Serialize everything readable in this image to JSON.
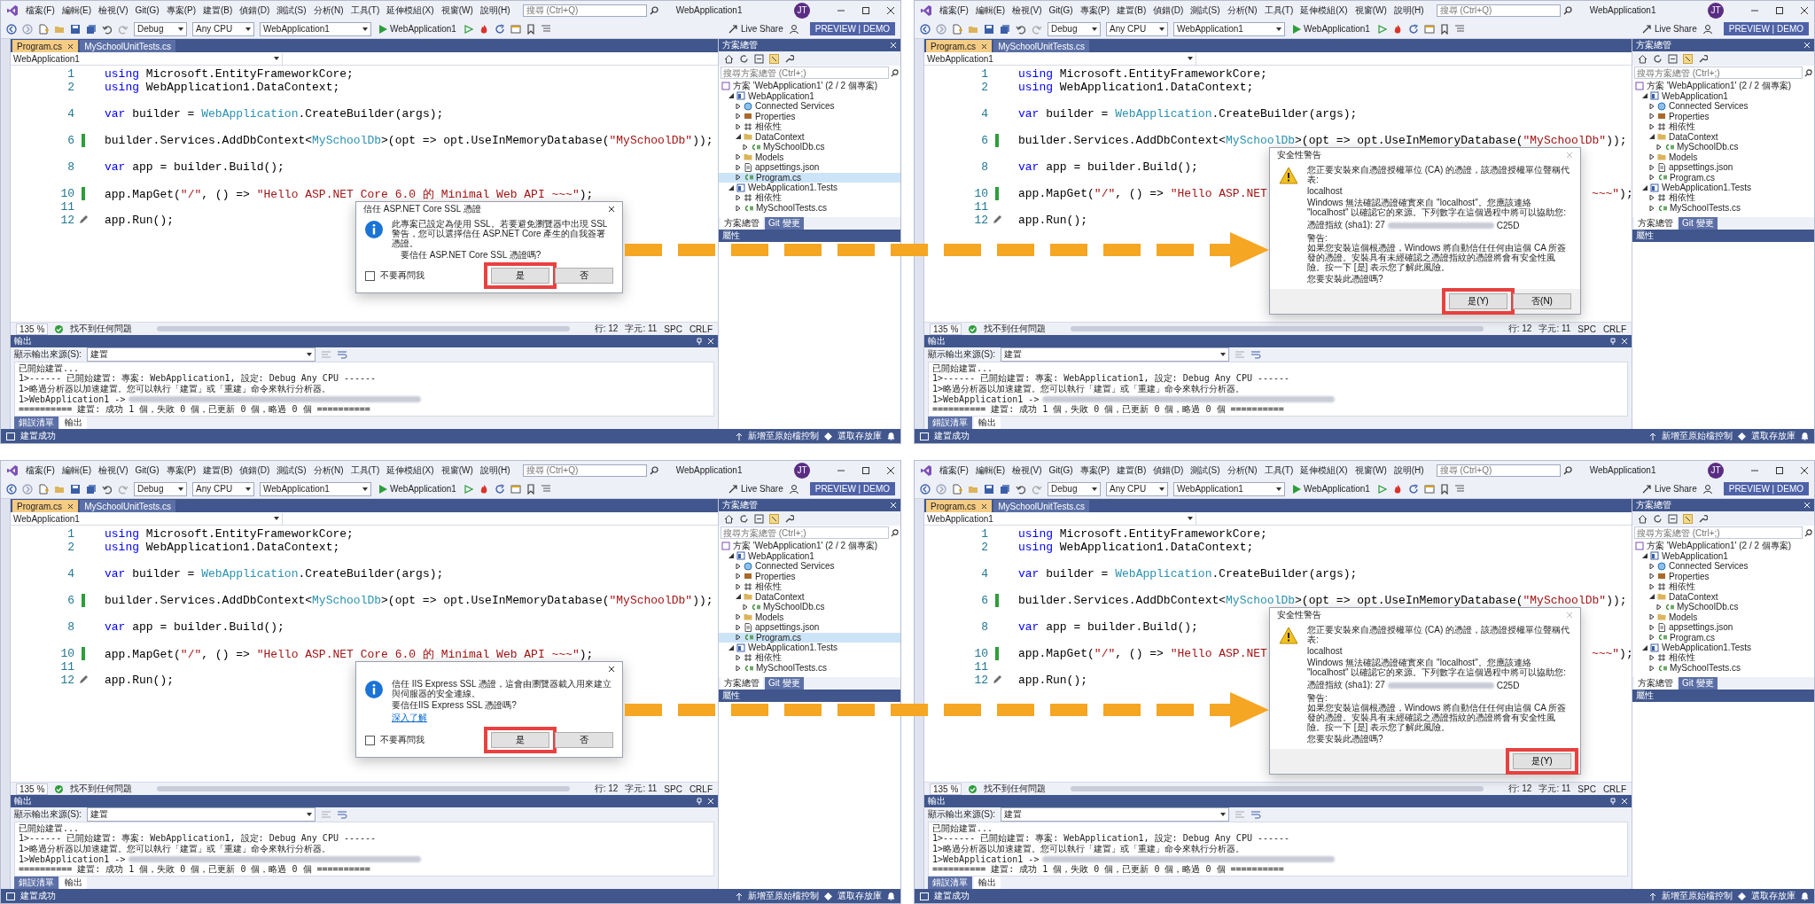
{
  "panels": [
    {
      "menu": [
        "檔案(F)",
        "編輯(E)",
        "檢視(V)",
        "Git(G)",
        "專案(P)",
        "建置(B)",
        "偵錯(D)",
        "測試(S)",
        "分析(N)",
        "工具(T)",
        "延伸模組(X)",
        "視窗(W)",
        "說明(H)"
      ],
      "search": {
        "placeholder": "搜尋 (Ctrl+Q)"
      },
      "title": "WebApplication1",
      "avatar": "JT",
      "toolbar": {
        "configuration": "Debug",
        "platform": "Any CPU",
        "startup_project": "WebApplication1",
        "run": "WebApplication1",
        "live_share": "Live Share",
        "badge": "PREVIEW | DEMO"
      },
      "doc_tabs": [
        {
          "label": "Program.cs",
          "selected": true
        },
        {
          "label": "MySchoolUnitTests.cs",
          "selected": false
        }
      ],
      "navigation": "WebApplication1",
      "code": [
        {
          "kind": "code",
          "number": "1",
          "changed": false,
          "tokens": [
            {
              "text": "using",
              "kind": "keyword"
            },
            {
              "text": " Microsoft.EntityFrameworkCore;",
              "kind": "plain"
            }
          ]
        },
        {
          "kind": "code",
          "number": "2",
          "changed": false,
          "tokens": [
            {
              "text": "using",
              "kind": "keyword"
            },
            {
              "text": " WebApplication1.DataContext;",
              "kind": "plain"
            }
          ]
        },
        {
          "kind": "blank"
        },
        {
          "kind": "code",
          "number": "4",
          "changed": false,
          "tokens": [
            {
              "text": "var",
              "kind": "keyword"
            },
            {
              "text": " builder = ",
              "kind": "plain"
            },
            {
              "text": "WebApplication",
              "kind": "type"
            },
            {
              "text": ".CreateBuilder(args);",
              "kind": "plain"
            }
          ]
        },
        {
          "kind": "blank"
        },
        {
          "kind": "code",
          "number": "6",
          "changed": true,
          "tokens": [
            {
              "text": "builder.Services.AddDbContext<",
              "kind": "plain"
            },
            {
              "text": "MySchoolDb",
              "kind": "type"
            },
            {
              "text": ">(opt => opt.UseInMemoryDatabase(",
              "kind": "plain"
            },
            {
              "text": "\"MySchoolDb\"",
              "kind": "string"
            },
            {
              "text": "));",
              "kind": "plain"
            }
          ]
        },
        {
          "kind": "blank"
        },
        {
          "kind": "code",
          "number": "8",
          "changed": false,
          "tokens": [
            {
              "text": "var",
              "kind": "keyword"
            },
            {
              "text": " app = builder.Build();",
              "kind": "plain"
            }
          ]
        },
        {
          "kind": "blank"
        },
        {
          "kind": "code",
          "number": "10",
          "changed": true,
          "tokens": [
            {
              "text": "app.MapGet(",
              "kind": "plain"
            },
            {
              "text": "\"/\"",
              "kind": "string"
            },
            {
              "text": ", () => ",
              "kind": "plain"
            },
            {
              "text": "\"Hello ASP.NET Core 6.0 的 Minimal Web API ~~~\"",
              "kind": "string"
            },
            {
              "text": ");",
              "kind": "plain"
            }
          ]
        },
        {
          "kind": "code",
          "number": "11",
          "changed": false
        },
        {
          "kind": "code",
          "number": "12",
          "changed": false,
          "quick_action": true,
          "tokens": [
            {
              "text": "app.Run();",
              "kind": "plain"
            }
          ]
        }
      ],
      "editor_status": {
        "zoom": "135 %",
        "issues": "找不到任何問題",
        "line": "行: 12",
        "column": "字元: 11",
        "spacing": "SPC",
        "line_ending": "CRLF"
      },
      "output": {
        "title": "輸出",
        "source_label": "顯示輸出來源(S):",
        "source": "建置",
        "lines": [
          {
            "text": "已開始建置...",
            "redacted": false
          },
          {
            "text": "1>------ 已開始建置: 專案: WebApplication1, 設定: Debug Any CPU ------",
            "redacted": false
          },
          {
            "text": "1>略過分析器以加速建置。您可以執行「建置」或「重建」命令來執行分析器。",
            "redacted": false
          },
          {
            "text": "1>WebApplication1 ->",
            "redacted": true
          },
          {
            "text": "========== 建置: 成功 1 個，失敗 0 個，已更新 0 個，略過 0 個 ==========",
            "redacted": false
          }
        ],
        "tabs": [
          {
            "label": "錯誤清單",
            "selected": false
          },
          {
            "label": "輸出",
            "selected": true
          }
        ]
      },
      "status": {
        "message": "建置成功",
        "source_control": "新增至原始檔控制",
        "repository": "選取存放庫"
      },
      "solution": {
        "title": "方案總管",
        "search": {
          "placeholder": "搜尋方案總管 (Ctrl+;)"
        },
        "tree": [
          {
            "label": "方案 'WebApplication1' (2 / 2 個專案)",
            "kind": "solution",
            "selected": false,
            "children": [
              {
                "label": "WebApplication1",
                "kind": "project",
                "expanded": true,
                "selected": false,
                "children": [
                  {
                    "label": "Connected Services",
                    "kind": "services",
                    "expanded": false,
                    "selected": false
                  },
                  {
                    "label": "Properties",
                    "kind": "properties",
                    "expanded": false,
                    "selected": false
                  },
                  {
                    "label": "相依性",
                    "kind": "dependencies",
                    "expanded": false,
                    "selected": false
                  },
                  {
                    "label": "DataContext",
                    "kind": "folder",
                    "expanded": true,
                    "selected": false,
                    "children": [
                      {
                        "label": "MySchoolDb.cs",
                        "kind": "csharp",
                        "expanded": false,
                        "selected": false
                      }
                    ]
                  },
                  {
                    "label": "Models",
                    "kind": "folder",
                    "expanded": false,
                    "selected": false
                  },
                  {
                    "label": "appsettings.json",
                    "kind": "json",
                    "expanded": false,
                    "selected": false
                  },
                  {
                    "label": "Program.cs",
                    "kind": "csharp",
                    "expanded": false,
                    "selected": true
                  }
                ]
              },
              {
                "label": "WebApplication1.Tests",
                "kind": "project",
                "expanded": true,
                "selected": false,
                "children": [
                  {
                    "label": "相依性",
                    "kind": "dependencies",
                    "expanded": false,
                    "selected": false
                  },
                  {
                    "label": "MySchoolTests.cs",
                    "kind": "csharp",
                    "expanded": false,
                    "selected": false
                  }
                ]
              }
            ]
          }
        ]
      },
      "side_tabs": [
        {
          "label": "方案總管",
          "selected": true
        },
        {
          "label": "Git 變更",
          "selected": false
        }
      ],
      "properties": {
        "title": "屬性"
      },
      "dialog": {
        "kind": "trust",
        "title": "信任 ASP.NET Core SSL 憑證",
        "message": "此專案已設定為使用 SSL。若要避免瀏覽器中出現 SSL 警告，您可以選擇信任 ASP.NET Core 產生的自我簽署憑證。",
        "question": "要信任 ASP.NET Core SSL 憑證嗎?",
        "checkbox": {
          "label": "不要再問我",
          "checked": false
        },
        "buttons": [
          {
            "label": "是",
            "highlighted": true
          },
          {
            "label": "否",
            "highlighted": false
          }
        ]
      }
    },
    {
      "menu": [
        "檔案(F)",
        "編輯(E)",
        "檢視(V)",
        "Git(G)",
        "專案(P)",
        "建置(B)",
        "偵錯(D)",
        "測試(S)",
        "分析(N)",
        "工具(T)",
        "延伸模組(X)",
        "視窗(W)",
        "說明(H)"
      ],
      "search": {
        "placeholder": "搜尋 (Ctrl+Q)"
      },
      "title": "WebApplication1",
      "avatar": "JT",
      "toolbar": {
        "configuration": "Debug",
        "platform": "Any CPU",
        "startup_project": "WebApplication1",
        "run": "WebApplication1",
        "live_share": "Live Share",
        "badge": "PREVIEW | DEMO"
      },
      "doc_tabs": [
        {
          "label": "Program.cs",
          "selected": true
        },
        {
          "label": "MySchoolUnitTests.cs",
          "selected": false
        }
      ],
      "navigation": "WebApplication1",
      "code": [
        {
          "kind": "code",
          "number": "1",
          "changed": false,
          "tokens": [
            {
              "text": "using",
              "kind": "keyword"
            },
            {
              "text": " Microsoft.EntityFrameworkCore;",
              "kind": "plain"
            }
          ]
        },
        {
          "kind": "code",
          "number": "2",
          "changed": false,
          "tokens": [
            {
              "text": "using",
              "kind": "keyword"
            },
            {
              "text": " WebApplication1.DataContext;",
              "kind": "plain"
            }
          ]
        },
        {
          "kind": "blank"
        },
        {
          "kind": "code",
          "number": "4",
          "changed": false,
          "tokens": [
            {
              "text": "var",
              "kind": "keyword"
            },
            {
              "text": " builder = ",
              "kind": "plain"
            },
            {
              "text": "WebApplication",
              "kind": "type"
            },
            {
              "text": ".CreateBuilder(args);",
              "kind": "plain"
            }
          ]
        },
        {
          "kind": "blank"
        },
        {
          "kind": "code",
          "number": "6",
          "changed": true,
          "tokens": [
            {
              "text": "builder.Services.AddDbContext<",
              "kind": "plain"
            },
            {
              "text": "MySchoolDb",
              "kind": "type"
            },
            {
              "text": ">(opt => opt.UseInMemoryDatabase(",
              "kind": "plain"
            },
            {
              "text": "\"MySchoolDb\"",
              "kind": "string"
            },
            {
              "text": "));",
              "kind": "plain"
            }
          ]
        },
        {
          "kind": "blank"
        },
        {
          "kind": "code",
          "number": "8",
          "changed": false,
          "tokens": [
            {
              "text": "var",
              "kind": "keyword"
            },
            {
              "text": " app = builder.Build();",
              "kind": "plain"
            }
          ]
        },
        {
          "kind": "blank"
        },
        {
          "kind": "code",
          "number": "10",
          "changed": true,
          "tokens": [
            {
              "text": "app.MapGet(",
              "kind": "plain"
            },
            {
              "text": "\"/\"",
              "kind": "string"
            },
            {
              "text": ", () => ",
              "kind": "plain"
            },
            {
              "text": "\"Hello ASP.NET",
              "kind": "string"
            },
            {
              "kind": "gap"
            },
            {
              "text": "~~~\"",
              "kind": "string"
            },
            {
              "text": ");",
              "kind": "plain"
            }
          ]
        },
        {
          "kind": "code",
          "number": "11",
          "changed": false
        },
        {
          "kind": "code",
          "number": "12",
          "changed": false,
          "quick_action": true,
          "tokens": [
            {
              "text": "app.Run();",
              "kind": "plain"
            }
          ]
        }
      ],
      "editor_status": {
        "zoom": "135 %",
        "issues": "找不到任何問題",
        "line": "行: 12",
        "column": "字元: 11",
        "spacing": "SPC",
        "line_ending": "CRLF"
      },
      "output": {
        "title": "輸出",
        "source_label": "顯示輸出來源(S):",
        "source": "建置",
        "lines": [
          {
            "text": "已開始建置...",
            "redacted": false
          },
          {
            "text": "1>------ 已開始建置: 專案: WebApplication1, 設定: Debug Any CPU ------",
            "redacted": false
          },
          {
            "text": "1>略過分析器以加速建置。您可以執行「建置」或「重建」命令來執行分析器。",
            "redacted": false
          },
          {
            "text": "1>WebApplication1 ->",
            "redacted": true
          },
          {
            "text": "========== 建置: 成功 1 個，失敗 0 個，已更新 0 個，略過 0 個 ==========",
            "redacted": false
          }
        ],
        "tabs": [
          {
            "label": "錯誤清單",
            "selected": false
          },
          {
            "label": "輸出",
            "selected": true
          }
        ]
      },
      "status": {
        "message": "建置成功",
        "source_control": "新增至原始檔控制",
        "repository": "選取存放庫"
      },
      "solution": {
        "title": "方案總管",
        "search": {
          "placeholder": "搜尋方案總管 (Ctrl+;)"
        },
        "tree": [
          {
            "label": "方案 'WebApplication1' (2 / 2 個專案)",
            "kind": "solution",
            "selected": false,
            "children": [
              {
                "label": "WebApplication1",
                "kind": "project",
                "expanded": true,
                "selected": false,
                "children": [
                  {
                    "label": "Connected Services",
                    "kind": "services",
                    "expanded": false,
                    "selected": false
                  },
                  {
                    "label": "Properties",
                    "kind": "properties",
                    "expanded": false,
                    "selected": false
                  },
                  {
                    "label": "相依性",
                    "kind": "dependencies",
                    "expanded": false,
                    "selected": false
                  },
                  {
                    "label": "DataContext",
                    "kind": "folder",
                    "expanded": true,
                    "selected": false,
                    "children": [
                      {
                        "label": "MySchoolDb.cs",
                        "kind": "csharp",
                        "expanded": false,
                        "selected": false
                      }
                    ]
                  },
                  {
                    "label": "Models",
                    "kind": "folder",
                    "expanded": false,
                    "selected": false
                  },
                  {
                    "label": "appsettings.json",
                    "kind": "json",
                    "expanded": false,
                    "selected": false
                  },
                  {
                    "label": "Program.cs",
                    "kind": "csharp",
                    "expanded": false,
                    "selected": false
                  }
                ]
              },
              {
                "label": "WebApplication1.Tests",
                "kind": "project",
                "expanded": true,
                "selected": false,
                "children": [
                  {
                    "label": "相依性",
                    "kind": "dependencies",
                    "expanded": false,
                    "selected": false
                  },
                  {
                    "label": "MySchoolTests.cs",
                    "kind": "csharp",
                    "expanded": false,
                    "selected": false
                  }
                ]
              }
            ]
          }
        ]
      },
      "side_tabs": [
        {
          "label": "方案總管",
          "selected": true
        },
        {
          "label": "Git 變更",
          "selected": false
        }
      ],
      "properties": {
        "title": "屬性"
      },
      "dialog": {
        "kind": "warning",
        "title": "安全性警告",
        "blocks": [
          {
            "kind": "text",
            "text": "您正要安裝來自憑證授權單位 (CA) 的憑證，該憑證授權單位聲稱代表:"
          },
          {
            "kind": "text",
            "text": "localhost"
          },
          {
            "kind": "text",
            "text": "Windows 無法確認憑證確實來自 \"localhost\"。您應該連絡 \"localhost\" 以確認它的來源。下列數字在這個過程中將可以協助您:"
          },
          {
            "kind": "thumbprint",
            "text": "憑證指紋 (sha1): 27",
            "tail": "C25D"
          },
          {
            "kind": "text",
            "text": "警告:\n如果您安裝這個根憑證，Windows 將自動信任任何由這個 CA 所簽發的憑證。安裝具有未經確認之憑證指紋的憑證將會有安全性風險。按一下 [是] 表示您了解此風險。"
          },
          {
            "kind": "text",
            "text": "您要安裝此憑證嗎?"
          }
        ],
        "buttons": [
          {
            "label": "是(Y)",
            "highlighted": true
          },
          {
            "label": "否(N)",
            "highlighted": false
          }
        ]
      }
    },
    {
      "menu": [
        "檔案(F)",
        "編輯(E)",
        "檢視(V)",
        "Git(G)",
        "專案(P)",
        "建置(B)",
        "偵錯(D)",
        "測試(S)",
        "分析(N)",
        "工具(T)",
        "延伸模組(X)",
        "視窗(W)",
        "說明(H)"
      ],
      "search": {
        "placeholder": "搜尋 (Ctrl+Q)"
      },
      "title": "WebApplication1",
      "avatar": "JT",
      "toolbar": {
        "configuration": "Debug",
        "platform": "Any CPU",
        "startup_project": "WebApplication1",
        "run": "WebApplication1",
        "live_share": "Live Share",
        "badge": "PREVIEW | DEMO"
      },
      "doc_tabs": [
        {
          "label": "Program.cs",
          "selected": true
        },
        {
          "label": "MySchoolUnitTests.cs",
          "selected": false
        }
      ],
      "navigation": "WebApplication1",
      "code": [
        {
          "kind": "code",
          "number": "1",
          "changed": false,
          "tokens": [
            {
              "text": "using",
              "kind": "keyword"
            },
            {
              "text": " Microsoft.EntityFrameworkCore;",
              "kind": "plain"
            }
          ]
        },
        {
          "kind": "code",
          "number": "2",
          "changed": false,
          "tokens": [
            {
              "text": "using",
              "kind": "keyword"
            },
            {
              "text": " WebApplication1.DataContext;",
              "kind": "plain"
            }
          ]
        },
        {
          "kind": "blank"
        },
        {
          "kind": "code",
          "number": "4",
          "changed": false,
          "tokens": [
            {
              "text": "var",
              "kind": "keyword"
            },
            {
              "text": " builder = ",
              "kind": "plain"
            },
            {
              "text": "WebApplication",
              "kind": "type"
            },
            {
              "text": ".CreateBuilder(args);",
              "kind": "plain"
            }
          ]
        },
        {
          "kind": "blank"
        },
        {
          "kind": "code",
          "number": "6",
          "changed": true,
          "tokens": [
            {
              "text": "builder.Services.AddDbContext<",
              "kind": "plain"
            },
            {
              "text": "MySchoolDb",
              "kind": "type"
            },
            {
              "text": ">(opt => opt.UseInMemoryDatabase(",
              "kind": "plain"
            },
            {
              "text": "\"MySchoolDb\"",
              "kind": "string"
            },
            {
              "text": "));",
              "kind": "plain"
            }
          ]
        },
        {
          "kind": "blank"
        },
        {
          "kind": "code",
          "number": "8",
          "changed": false,
          "tokens": [
            {
              "text": "var",
              "kind": "keyword"
            },
            {
              "text": " app = builder.Build();",
              "kind": "plain"
            }
          ]
        },
        {
          "kind": "blank"
        },
        {
          "kind": "code",
          "number": "10",
          "changed": true,
          "tokens": [
            {
              "text": "app.MapGet(",
              "kind": "plain"
            },
            {
              "text": "\"/\"",
              "kind": "string"
            },
            {
              "text": ", () => ",
              "kind": "plain"
            },
            {
              "text": "\"Hello ASP.NET Core 6.0 的 Minimal Web API ~~~\"",
              "kind": "string"
            },
            {
              "text": ");",
              "kind": "plain"
            }
          ]
        },
        {
          "kind": "code",
          "number": "11",
          "changed": false
        },
        {
          "kind": "code",
          "number": "12",
          "changed": false,
          "quick_action": true,
          "tokens": [
            {
              "text": "app.Run();",
              "kind": "plain"
            }
          ]
        }
      ],
      "editor_status": {
        "zoom": "135 %",
        "issues": "找不到任何問題",
        "line": "行: 12",
        "column": "字元: 11",
        "spacing": "SPC",
        "line_ending": "CRLF"
      },
      "output": {
        "title": "輸出",
        "source_label": "顯示輸出來源(S):",
        "source": "建置",
        "lines": [
          {
            "text": "已開始建置...",
            "redacted": false
          },
          {
            "text": "1>------ 已開始建置: 專案: WebApplication1, 設定: Debug Any CPU ------",
            "redacted": false
          },
          {
            "text": "1>略過分析器以加速建置。您可以執行「建置」或「重建」命令來執行分析器。",
            "redacted": false
          },
          {
            "text": "1>WebApplication1 ->",
            "redacted": true
          },
          {
            "text": "========== 建置: 成功 1 個，失敗 0 個，已更新 0 個，略過 0 個 ==========",
            "redacted": false
          }
        ],
        "tabs": [
          {
            "label": "錯誤清單",
            "selected": false
          },
          {
            "label": "輸出",
            "selected": true
          }
        ]
      },
      "status": {
        "message": "建置成功",
        "source_control": "新增至原始檔控制",
        "repository": "選取存放庫"
      },
      "solution": {
        "title": "方案總管",
        "search": {
          "placeholder": "搜尋方案總管 (Ctrl+;)"
        },
        "tree": [
          {
            "label": "方案 'WebApplication1' (2 / 2 個專案)",
            "kind": "solution",
            "selected": false,
            "children": [
              {
                "label": "WebApplication1",
                "kind": "project",
                "expanded": true,
                "selected": false,
                "children": [
                  {
                    "label": "Connected Services",
                    "kind": "services",
                    "expanded": false,
                    "selected": false
                  },
                  {
                    "label": "Properties",
                    "kind": "properties",
                    "expanded": false,
                    "selected": false
                  },
                  {
                    "label": "相依性",
                    "kind": "dependencies",
                    "expanded": false,
                    "selected": false
                  },
                  {
                    "label": "DataContext",
                    "kind": "folder",
                    "expanded": true,
                    "selected": false,
                    "children": [
                      {
                        "label": "MySchoolDb.cs",
                        "kind": "csharp",
                        "expanded": false,
                        "selected": false
                      }
                    ]
                  },
                  {
                    "label": "Models",
                    "kind": "folder",
                    "expanded": false,
                    "selected": false
                  },
                  {
                    "label": "appsettings.json",
                    "kind": "json",
                    "expanded": false,
                    "selected": false
                  },
                  {
                    "label": "Program.cs",
                    "kind": "csharp",
                    "expanded": false,
                    "selected": true
                  }
                ]
              },
              {
                "label": "WebApplication1.Tests",
                "kind": "project",
                "expanded": true,
                "selected": false,
                "children": [
                  {
                    "label": "相依性",
                    "kind": "dependencies",
                    "expanded": false,
                    "selected": false
                  },
                  {
                    "label": "MySchoolTests.cs",
                    "kind": "csharp",
                    "expanded": false,
                    "selected": false
                  }
                ]
              }
            ]
          }
        ]
      },
      "side_tabs": [
        {
          "label": "方案總管",
          "selected": true
        },
        {
          "label": "Git 變更",
          "selected": false
        }
      ],
      "properties": {
        "title": "屬性"
      },
      "dialog": {
        "kind": "trust",
        "message": "信任 IIS Express SSL 憑證，這會由瀏覽器載入用來建立與伺服器的安全連線。",
        "question": "要信任IIS Express SSL 憑證嗎?",
        "link": "深入了解",
        "checkbox": {
          "label": "不要再問我",
          "checked": false
        },
        "buttons": [
          {
            "label": "是",
            "highlighted": true
          },
          {
            "label": "否",
            "highlighted": false
          }
        ]
      }
    },
    {
      "menu": [
        "檔案(F)",
        "編輯(E)",
        "檢視(V)",
        "Git(G)",
        "專案(P)",
        "建置(B)",
        "偵錯(D)",
        "測試(S)",
        "分析(N)",
        "工具(T)",
        "延伸模組(X)",
        "視窗(W)",
        "說明(H)"
      ],
      "search": {
        "placeholder": "搜尋 (Ctrl+Q)"
      },
      "title": "WebApplication1",
      "avatar": "JT",
      "toolbar": {
        "configuration": "Debug",
        "platform": "Any CPU",
        "startup_project": "WebApplication1",
        "run": "WebApplication1",
        "live_share": "Live Share",
        "badge": "PREVIEW | DEMO"
      },
      "doc_tabs": [
        {
          "label": "Program.cs",
          "selected": true
        },
        {
          "label": "MySchoolUnitTests.cs",
          "selected": false
        }
      ],
      "navigation": "WebApplication1",
      "code": [
        {
          "kind": "code",
          "number": "1",
          "changed": false,
          "tokens": [
            {
              "text": "using",
              "kind": "keyword"
            },
            {
              "text": " Microsoft.EntityFrameworkCore;",
              "kind": "plain"
            }
          ]
        },
        {
          "kind": "code",
          "number": "2",
          "changed": false,
          "tokens": [
            {
              "text": "using",
              "kind": "keyword"
            },
            {
              "text": " WebApplication1.DataContext;",
              "kind": "plain"
            }
          ]
        },
        {
          "kind": "blank"
        },
        {
          "kind": "code",
          "number": "4",
          "changed": false,
          "tokens": [
            {
              "text": "var",
              "kind": "keyword"
            },
            {
              "text": " builder = ",
              "kind": "plain"
            },
            {
              "text": "WebApplication",
              "kind": "type"
            },
            {
              "text": ".CreateBuilder(args);",
              "kind": "plain"
            }
          ]
        },
        {
          "kind": "blank"
        },
        {
          "kind": "code",
          "number": "6",
          "changed": true,
          "tokens": [
            {
              "text": "builder.Services.AddDbContext<",
              "kind": "plain"
            },
            {
              "text": "MySchoolDb",
              "kind": "type"
            },
            {
              "text": ">(opt => opt.UseInMemoryDatabase(",
              "kind": "plain"
            },
            {
              "text": "\"MySchoolDb\"",
              "kind": "string"
            },
            {
              "text": "));",
              "kind": "plain"
            }
          ]
        },
        {
          "kind": "blank"
        },
        {
          "kind": "code",
          "number": "8",
          "changed": false,
          "tokens": [
            {
              "text": "var",
              "kind": "keyword"
            },
            {
              "text": " app = builder.Build();",
              "kind": "plain"
            }
          ]
        },
        {
          "kind": "blank"
        },
        {
          "kind": "code",
          "number": "10",
          "changed": true,
          "tokens": [
            {
              "text": "app.MapGet(",
              "kind": "plain"
            },
            {
              "text": "\"/\"",
              "kind": "string"
            },
            {
              "text": ", () => ",
              "kind": "plain"
            },
            {
              "text": "\"Hello ASP.NET",
              "kind": "string"
            },
            {
              "kind": "gap"
            },
            {
              "text": "~~~\"",
              "kind": "string"
            },
            {
              "text": ");",
              "kind": "plain"
            }
          ]
        },
        {
          "kind": "code",
          "number": "11",
          "changed": false
        },
        {
          "kind": "code",
          "number": "12",
          "changed": false,
          "quick_action": true,
          "tokens": [
            {
              "text": "app.Run();",
              "kind": "plain"
            }
          ]
        }
      ],
      "editor_status": {
        "zoom": "135 %",
        "issues": "找不到任何問題",
        "line": "行: 12",
        "column": "字元: 11",
        "spacing": "SPC",
        "line_ending": "CRLF"
      },
      "output": {
        "title": "輸出",
        "source_label": "顯示輸出來源(S):",
        "source": "建置",
        "lines": [
          {
            "text": "已開始建置...",
            "redacted": false
          },
          {
            "text": "1>------ 已開始建置: 專案: WebApplication1, 設定: Debug Any CPU ------",
            "redacted": false
          },
          {
            "text": "1>略過分析器以加速建置。您可以執行「建置」或「重建」命令來執行分析器。",
            "redacted": false
          },
          {
            "text": "1>WebApplication1 ->",
            "redacted": true
          },
          {
            "text": "========== 建置: 成功 1 個，失敗 0 個，已更新 0 個，略過 0 個 ==========",
            "redacted": false
          }
        ],
        "tabs": [
          {
            "label": "錯誤清單",
            "selected": false
          },
          {
            "label": "輸出",
            "selected": true
          }
        ]
      },
      "status": {
        "message": "建置成功",
        "source_control": "新增至原始檔控制",
        "repository": "選取存放庫"
      },
      "solution": {
        "title": "方案總管",
        "search": {
          "placeholder": "搜尋方案總管 (Ctrl+;)"
        },
        "tree": [
          {
            "label": "方案 'WebApplication1' (2 / 2 個專案)",
            "kind": "solution",
            "selected": false,
            "children": [
              {
                "label": "WebApplication1",
                "kind": "project",
                "expanded": true,
                "selected": false,
                "children": [
                  {
                    "label": "Connected Services",
                    "kind": "services",
                    "expanded": false,
                    "selected": false
                  },
                  {
                    "label": "Properties",
                    "kind": "properties",
                    "expanded": false,
                    "selected": false
                  },
                  {
                    "label": "相依性",
                    "kind": "dependencies",
                    "expanded": false,
                    "selected": false
                  },
                  {
                    "label": "DataContext",
                    "kind": "folder",
                    "expanded": true,
                    "selected": false,
                    "children": [
                      {
                        "label": "MySchoolDb.cs",
                        "kind": "csharp",
                        "expanded": false,
                        "selected": false
                      }
                    ]
                  },
                  {
                    "label": "Models",
                    "kind": "folder",
                    "expanded": false,
                    "selected": false
                  },
                  {
                    "label": "appsettings.json",
                    "kind": "json",
                    "expanded": false,
                    "selected": false
                  },
                  {
                    "label": "Program.cs",
                    "kind": "csharp",
                    "expanded": false,
                    "selected": false
                  }
                ]
              },
              {
                "label": "WebApplication1.Tests",
                "kind": "project",
                "expanded": true,
                "selected": false,
                "children": [
                  {
                    "label": "相依性",
                    "kind": "dependencies",
                    "expanded": false,
                    "selected": false
                  },
                  {
                    "label": "MySchoolTests.cs",
                    "kind": "csharp",
                    "expanded": false,
                    "selected": false
                  }
                ]
              }
            ]
          }
        ]
      },
      "side_tabs": [
        {
          "label": "方案總管",
          "selected": true
        },
        {
          "label": "Git 變更",
          "selected": false
        }
      ],
      "properties": {
        "title": "屬性"
      },
      "dialog": {
        "kind": "warning",
        "title": "安全性警告",
        "blocks": [
          {
            "kind": "text",
            "text": "您正要安裝來自憑證授權單位 (CA) 的憑證，該憑證授權單位聲稱代表:"
          },
          {
            "kind": "text",
            "text": "localhost"
          },
          {
            "kind": "text",
            "text": "Windows 無法確認憑證確實來自 \"localhost\"。您應該連絡 \"localhost\" 以確認它的來源。下列數字在這個過程中將可以協助您:"
          },
          {
            "kind": "thumbprint",
            "text": "憑證指紋 (sha1): 27",
            "tail": "C25D"
          },
          {
            "kind": "text",
            "text": "警告:\n如果您安裝這個根憑證，Windows 將自動信任任何由這個 CA 所簽發的憑證。安裝具有未經確認之憑證指紋的憑證將會有安全性風險。按一下 [是] 表示您了解此風險。"
          },
          {
            "kind": "text",
            "text": "您要安裝此憑證嗎?"
          }
        ],
        "buttons": [
          {
            "label": "是(Y)",
            "highlighted": true
          }
        ]
      }
    }
  ]
}
